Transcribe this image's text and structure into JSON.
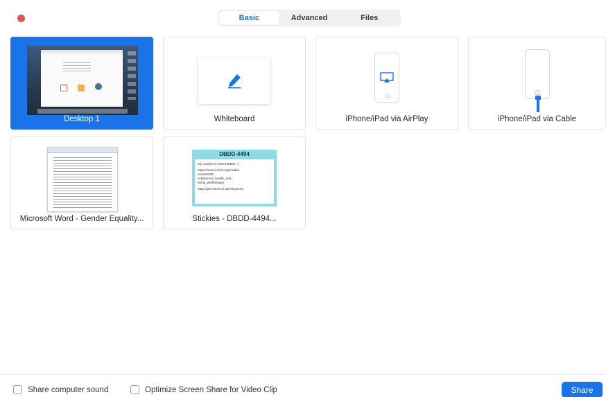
{
  "window": {
    "close_color": "#e8534a"
  },
  "tabs": [
    {
      "label": "Basic",
      "active": true
    },
    {
      "label": "Advanced",
      "active": false
    },
    {
      "label": "Files",
      "active": false
    }
  ],
  "sources": [
    {
      "label": "Desktop 1",
      "selected": true,
      "thumbnail": "desktop-screenshot"
    },
    {
      "label": "Whiteboard",
      "selected": false,
      "thumbnail": "pencil-icon"
    },
    {
      "label": "iPhone/iPad via AirPlay",
      "selected": false,
      "thumbnail": "airplay-phone-icon"
    },
    {
      "label": "iPhone/iPad via Cable",
      "selected": false,
      "thumbnail": "cable-phone-icon"
    },
    {
      "label": "Microsoft Word - Gender Equality...",
      "selected": false,
      "thumbnail": "word-document"
    },
    {
      "label": "Stickies - DBDD-4494...",
      "selected": false,
      "thumbnail": "sticky-note"
    }
  ],
  "sticky_preview": {
    "title": "DBDD-4494",
    "lines": [
      "My number is 0407158802 :-)",
      "https://www.unicef.org/media/",
      "news/2020/",
      "Adolescent_health_and_",
      "being_welltherapy/",
      "",
      "https://pensions.co.uk/resources"
    ]
  },
  "footer": {
    "share_sound_label": "Share computer sound",
    "optimize_label": "Optimize Screen Share for Video Clip",
    "share_button_label": "Share"
  },
  "colors": {
    "accent": "#1a73e8",
    "cable": "#1a73e8"
  }
}
